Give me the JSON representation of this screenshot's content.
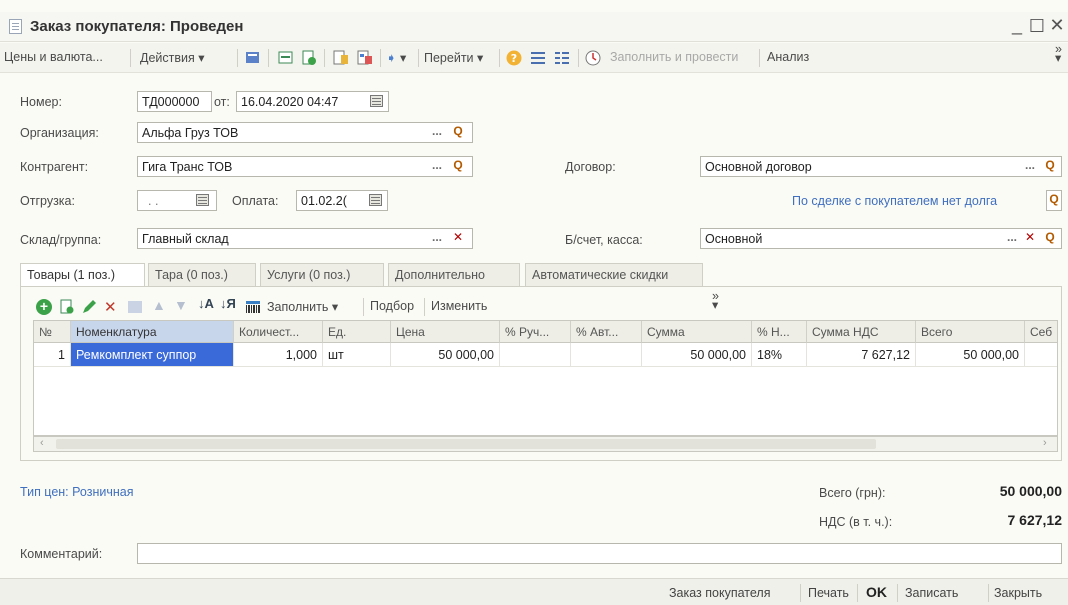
{
  "window": {
    "title": "Заказ покупателя: Проведен"
  },
  "toolbar": {
    "prices": "Цены и валюта...",
    "actions": "Действия",
    "goto": "Перейти",
    "fill_and_post": "Заполнить и провести",
    "analysis": "Анализ"
  },
  "header": {
    "number_label": "Номер:",
    "number_value": "ТД000000",
    "date_from_label": "от:",
    "date_value": "16.04.2020 04:47",
    "org_label": "Организация:",
    "org_value": "Альфа Груз ТОВ",
    "counterparty_label": "Контрагент:",
    "counterparty_value": "Гига Транс ТОВ",
    "contract_label": "Договор:",
    "contract_value": "Основной договор",
    "shipment_label": "Отгрузка:",
    "shipment_value": ". .",
    "payment_label": "Оплата:",
    "payment_value": "01.02.2(",
    "debt_link": "По сделке с покупателем нет долга",
    "warehouse_label": "Склад/группа:",
    "warehouse_value": "Главный склад",
    "account_label": "Б/счет, касса:",
    "account_value": "Основной"
  },
  "tabs": [
    {
      "label": "Товары (1 поз.)"
    },
    {
      "label": "Тара (0 поз.)"
    },
    {
      "label": "Услуги (0 поз.)"
    },
    {
      "label": "Дополнительно"
    },
    {
      "label": "Автоматические скидки"
    }
  ],
  "table_toolbar": {
    "fill": "Заполнить",
    "select": "Подбор",
    "change": "Изменить"
  },
  "grid": {
    "columns": [
      "№",
      "Номенклатура",
      "Количест...",
      "Ед.",
      "Цена",
      "% Руч...",
      "% Авт...",
      "Сумма",
      "% Н...",
      "Сумма НДС",
      "Всего",
      "Себ"
    ],
    "rows": [
      {
        "n": "1",
        "item": "Ремкомплект суппор",
        "qty": "1,000",
        "unit": "шт",
        "price": "50 000,00",
        "manual": "",
        "auto": "",
        "sum": "50 000,00",
        "vat_rate": "18%",
        "vat_sum": "7 627,12",
        "total": "50 000,00",
        "cost": ""
      }
    ]
  },
  "footer": {
    "price_type": "Тип цен: Розничная",
    "total_label": "Всего (грн):",
    "total_value": "50 000,00",
    "vat_label": "НДС (в т. ч.):",
    "vat_value": "7 627,12",
    "comment_label": "Комментарий:",
    "comment_value": ""
  },
  "bottom": {
    "customer_order": "Заказ покупателя",
    "print": "Печать",
    "ok": "OK",
    "save": "Записать",
    "close": "Закрыть"
  },
  "colors": {
    "selection": "#3a6ad9",
    "link": "#3f6fbf",
    "add_green": "#3ca24a",
    "delete_red": "#b40000"
  }
}
